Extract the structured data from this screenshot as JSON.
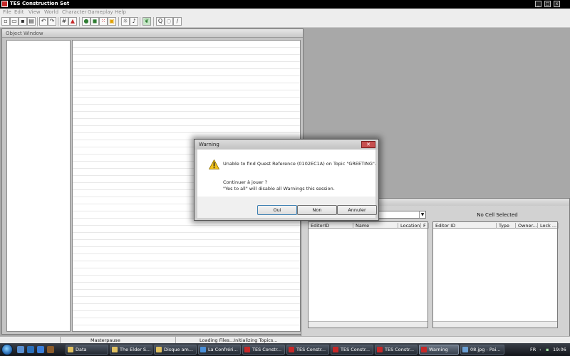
{
  "app": {
    "title": "TES Construction Set"
  },
  "menu": [
    "File",
    "Edit",
    "View",
    "World",
    "Character",
    "Gameplay",
    "Help"
  ],
  "object_window": {
    "title": "Object Window"
  },
  "cell_view": {
    "no_cell_label": "No Cell Selected",
    "cell_list_columns": [
      "EditorID",
      "Name",
      "Location",
      "F"
    ],
    "ref_list_columns": [
      "Editor ID",
      "Type",
      "Owner...",
      "Lock ..."
    ]
  },
  "dialog": {
    "title": "Warning",
    "close_glyph": "✕",
    "message": "Unable to find Quest Reference (0102EC1A) on Topic \"GREETING\".",
    "question": "Continuer à jouer ?",
    "note": "\"Yes to all\" will disable all Warnings this session.",
    "buttons": {
      "yes": "Oui",
      "no": "Non",
      "cancel": "Annuler"
    }
  },
  "status": {
    "master": "Masterpause",
    "loading": "Loading Files...Initializing Topics..."
  },
  "taskbar": {
    "buttons": [
      {
        "label": "Data",
        "color": "#e0c060"
      },
      {
        "label": "The Elder S...",
        "color": "#e0c060"
      },
      {
        "label": "Disque am...",
        "color": "#e0c060"
      },
      {
        "label": "La Confréri...",
        "color": "#4a90d9"
      },
      {
        "label": "TES Constr...",
        "color": "#c62828"
      },
      {
        "label": "TES Constr...",
        "color": "#c62828"
      },
      {
        "label": "TES Constr...",
        "color": "#c62828"
      },
      {
        "label": "TES Constr...",
        "color": "#c62828"
      },
      {
        "label": "Warning",
        "color": "#c62828"
      },
      {
        "label": "08.jpg - Pai...",
        "color": "#6a9fd4"
      }
    ],
    "lang": "FR",
    "clock": "19:06"
  }
}
